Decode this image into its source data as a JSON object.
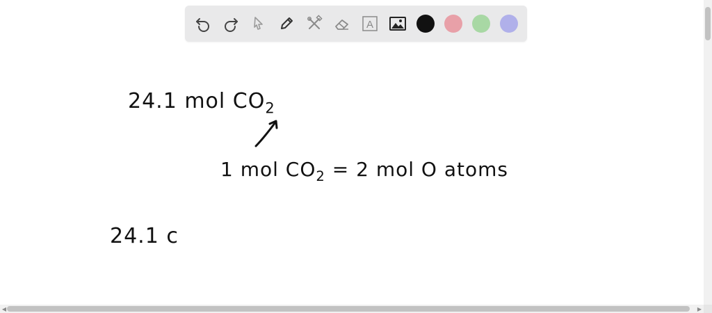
{
  "toolbar": {
    "tools": [
      {
        "name": "undo-icon"
      },
      {
        "name": "redo-icon"
      },
      {
        "name": "pointer-icon"
      },
      {
        "name": "pen-icon"
      },
      {
        "name": "tools-icon"
      },
      {
        "name": "eraser-icon"
      },
      {
        "name": "text-icon",
        "glyph": "A"
      },
      {
        "name": "image-icon"
      }
    ],
    "colors": {
      "black": "#111111",
      "red": "#e8a0a8",
      "green": "#a8d8a4",
      "blue": "#b0b0ea"
    }
  },
  "canvas": {
    "line1": {
      "text": "24.1 mol CO",
      "sub": "2"
    },
    "line2": {
      "prefix": "1 mol CO",
      "sub": "2",
      "suffix": " = 2 mol O atoms"
    },
    "line3": {
      "text": "24.1 c"
    }
  }
}
